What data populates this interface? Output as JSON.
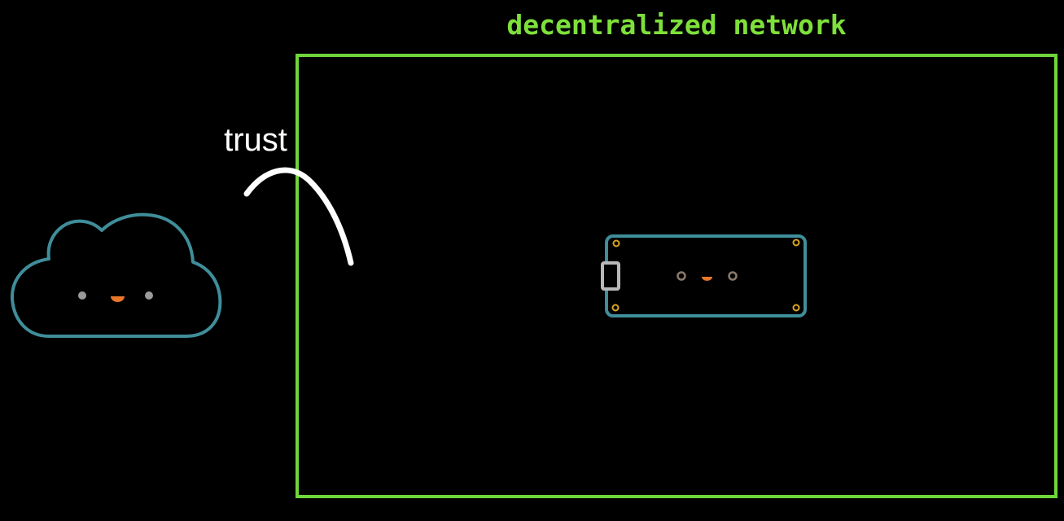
{
  "network": {
    "title": "decentralized network"
  },
  "trust": {
    "label": "trust"
  },
  "colors": {
    "background": "#000000",
    "network_border": "#6fd63a",
    "network_title": "#7ee03a",
    "cloud_outline": "#3f8e9a",
    "device_outline": "#3f8e9a",
    "eye": "#9a9a9a",
    "device_eye": "#8a7a6a",
    "mouth": "#e8772a",
    "mounting_hole": "#d9a420",
    "connector": "#b8b8b8",
    "trust_text": "#ffffff",
    "trust_arc": "#ffffff"
  },
  "icons": {
    "cloud": "cloud-icon",
    "device": "microcontroller-board-icon",
    "arc": "trust-arc"
  }
}
